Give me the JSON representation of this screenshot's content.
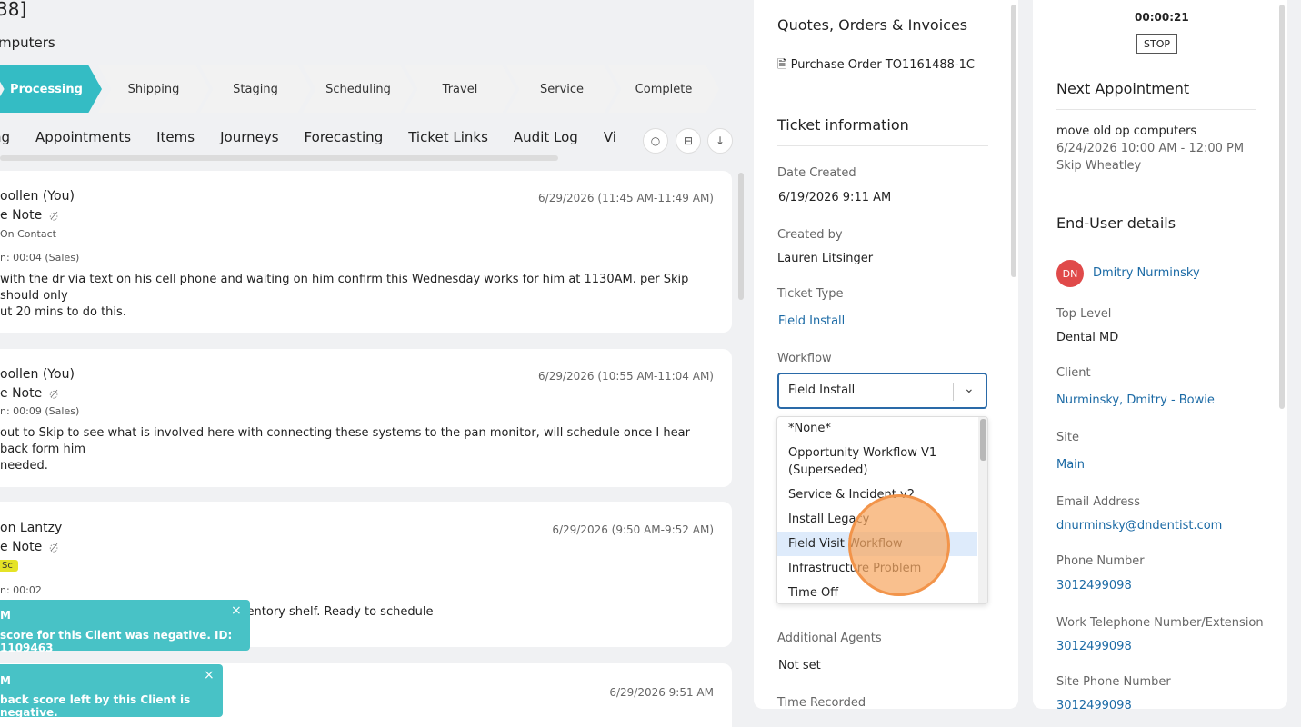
{
  "left": {
    "title": "38]",
    "subtitle": "mputers",
    "stages": [
      "Processing",
      "Shipping",
      "Staging",
      "Scheduling",
      "Travel",
      "Service",
      "Complete"
    ],
    "tabs": [
      "ng",
      "Appointments",
      "Items",
      "Journeys",
      "Forecasting",
      "Ticket Links",
      "Audit Log",
      "Vi"
    ],
    "actions": [
      {
        "name": "comment-icon",
        "glyph": "○"
      },
      {
        "name": "collapse-icon",
        "glyph": "⊟"
      },
      {
        "name": "arrow-down-icon",
        "glyph": "↓"
      }
    ],
    "cards": [
      {
        "who": "oollen (You)",
        "type": "e Note",
        "meta1": "On Contact",
        "meta2": "n: 00:04 (Sales)",
        "date": "6/29/2026 (11:45 AM-11:49 AM)",
        "body1": "with the dr via text on his cell phone and waiting on him confirm this Wednesday works for him at 1130AM.  per Skip should only",
        "body2": "ut 20 mins to do this."
      },
      {
        "who": "oollen (You)",
        "type": "e Note",
        "meta2": "n: 00:09 (Sales)",
        "date": "6/29/2026 (10:55 AM-11:04 AM)",
        "body1": "out to Skip to see what is involved here with connecting these systems to the pan monitor, will schedule once I hear back form him",
        "body2": "needed."
      },
      {
        "who": "on Lantzy",
        "type": "e Note",
        "tag": "Sc",
        "meta2": "n: 00:02",
        "date": "6/29/2026 (9:50 AM-9:52 AM)",
        "body1": "ollen-This arrived and is placed on the inventory shelf. Ready to schedule"
      },
      {
        "date": "6/29/2026 9:51 AM"
      }
    ],
    "toasts": [
      {
        "line1": "M",
        "line2": "score for this Client was negative. ID: 1109463",
        "close": "×"
      },
      {
        "line1": "M",
        "line2": "back score left by this Client is negative.",
        "close": "×"
      }
    ]
  },
  "mid": {
    "qoi_title": "Quotes, Orders & Invoices",
    "po": "Purchase Order TO1161488-1C",
    "ticket_info": "Ticket information",
    "date_created_label": "Date Created",
    "date_created": "6/19/2026 9:11 AM",
    "created_by_label": "Created by",
    "created_by": "Lauren Litsinger",
    "ticket_type_label": "Ticket Type",
    "ticket_type": "Field Install",
    "workflow_label": "Workflow",
    "workflow_value": "Field Install",
    "workflow_options": [
      "*None*",
      "Opportunity Workflow V1",
      "(Superseded)",
      "Service & Incident v2",
      "Install Legacy",
      "Field Visit Workflow",
      "Infrastructure Problem",
      "Time Off"
    ],
    "additional_agents_label": "Additional Agents",
    "additional_agents": "Not set",
    "time_recorded_label": "Time Recorded"
  },
  "right": {
    "timer": "00:00:21",
    "stop": "STOP",
    "next_appt_title": "Next Appointment",
    "appt_title": "move old op computers",
    "appt_time": "6/24/2026 10:00 AM - 12:00 PM",
    "appt_agent": "Skip Wheatley",
    "enduser_title": "End-User details",
    "avatar_initials": "DN",
    "user_name": "Dmitry Nurminsky",
    "top_level_label": "Top Level",
    "top_level": "Dental MD",
    "client_label": "Client",
    "client": "Nurminsky, Dmitry - Bowie",
    "site_label": "Site",
    "site": "Main",
    "email_label": "Email Address",
    "email": "dnurminsky@dndentist.com",
    "phone_label": "Phone Number",
    "phone": "3012499098",
    "work_phone_label": "Work Telephone Number/Extension",
    "work_phone": "3012499098",
    "site_phone_label": "Site Phone Number",
    "site_phone": "3012499098"
  }
}
